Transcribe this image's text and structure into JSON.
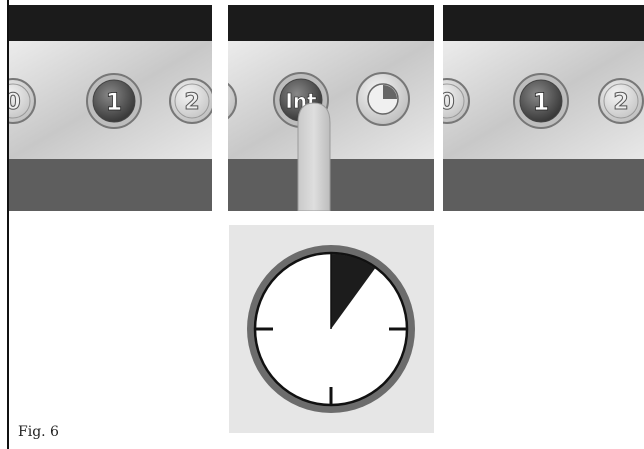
{
  "caption": "Fig. 6",
  "colors": {
    "top_band": "#1b1b1b",
    "brushed_light": "#e4e4e4",
    "brushed_dark": "#b8b8b8",
    "bottom_band": "#5e5e5e",
    "button_light_fill": "#dcdcdc",
    "button_dark_fill": "#5a5a5a",
    "timer_bg": "#e6e6e6",
    "timer_ring": "#6c6c6c",
    "elapsed_wedge": "#1c1c1c"
  },
  "panels": [
    {
      "id": "before",
      "buttons": [
        {
          "label": "0",
          "style": "light",
          "icon": "none"
        },
        {
          "label": "1",
          "style": "dark",
          "icon": "none"
        },
        {
          "label": "2",
          "style": "light",
          "icon": "none"
        }
      ],
      "finger": false
    },
    {
      "id": "press",
      "buttons": [
        {
          "label": "",
          "style": "light",
          "icon": "none"
        },
        {
          "label": "Int",
          "style": "dark",
          "icon": "none"
        },
        {
          "label": "",
          "style": "light",
          "icon": "timer-icon"
        }
      ],
      "finger": true
    },
    {
      "id": "after",
      "buttons": [
        {
          "label": "0",
          "style": "light",
          "icon": "none"
        },
        {
          "label": "1",
          "style": "dark",
          "icon": "none"
        },
        {
          "label": "2",
          "style": "light",
          "icon": "none"
        }
      ],
      "finger": false
    }
  ],
  "timer": {
    "icon": "clock-icon",
    "elapsed_fraction": 0.1,
    "tick_marks": [
      "right",
      "bottom",
      "left"
    ]
  }
}
